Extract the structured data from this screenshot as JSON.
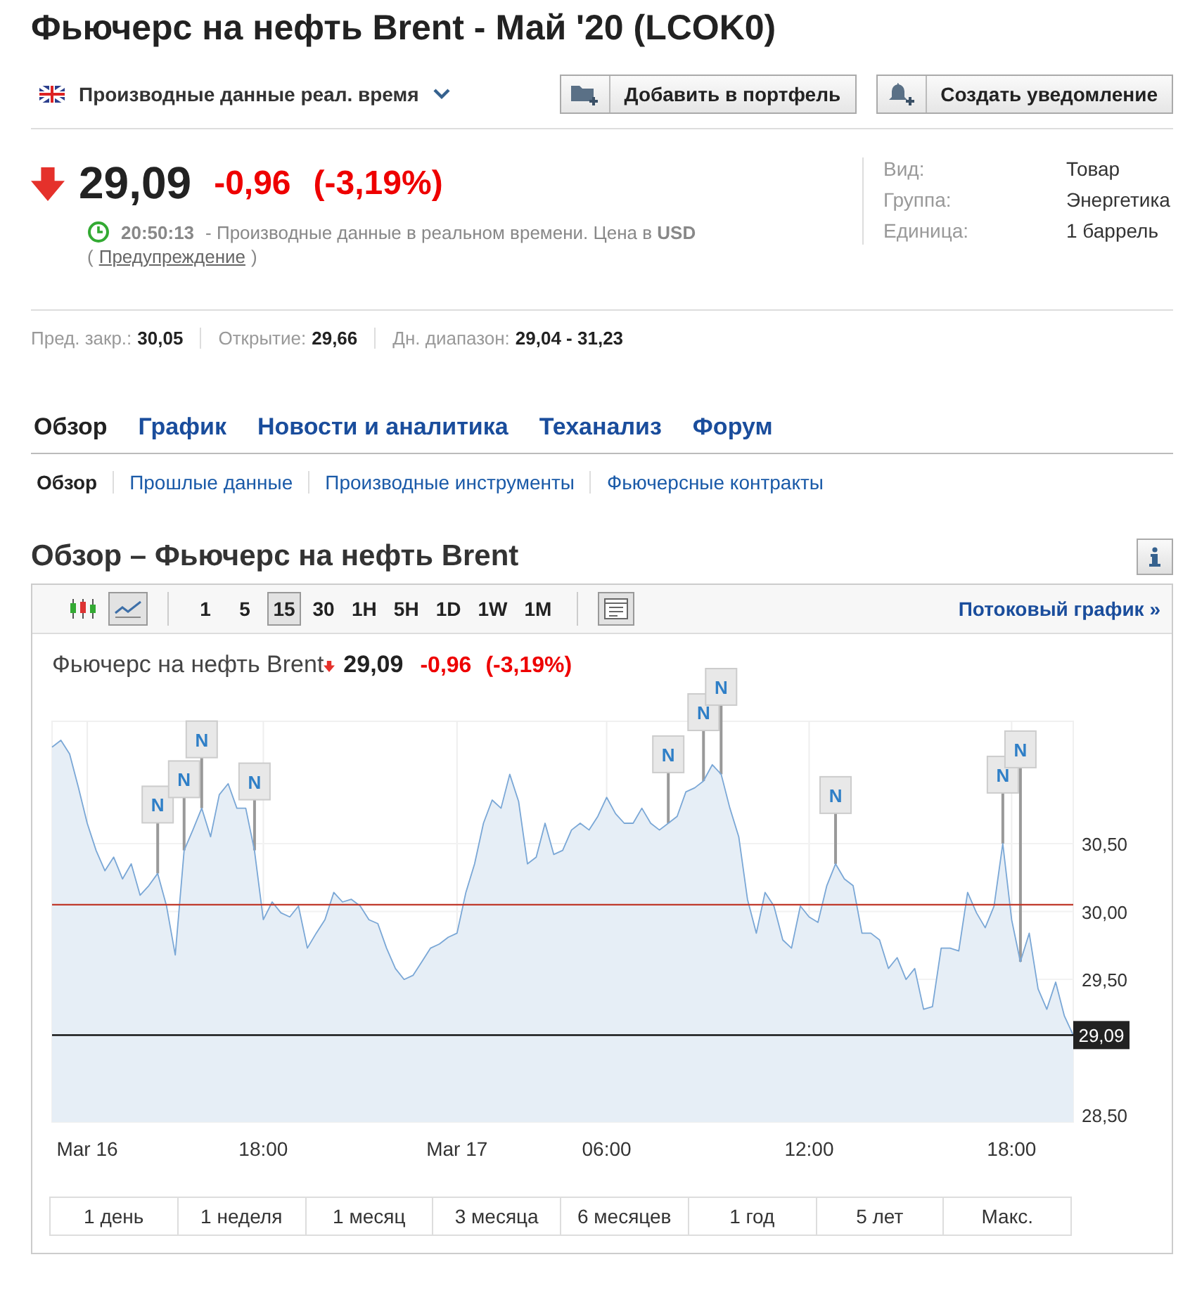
{
  "title": "Фьючерс на нефть Brent - Май '20 (LCOK0)",
  "data_source": {
    "label": "Производные данные реал. время"
  },
  "buttons": [
    {
      "kind": "portfolio",
      "label": "Добавить в портфель"
    },
    {
      "kind": "alert",
      "label": "Создать уведомление"
    }
  ],
  "quote": {
    "falling": true,
    "price": "29,09",
    "change": "-0,96",
    "change_percent": "(-3,19%)",
    "time": "20:50:13",
    "note": "- Производные данные в реальном времени. Цена в **USD**",
    "warning_open": "(",
    "warning_link": "Предупреждение",
    "warning_close": ")"
  },
  "info": [
    {
      "label": "Вид:",
      "value": "Товар"
    },
    {
      "label": "Группа:",
      "value": "Энергетика"
    },
    {
      "label": "Единица:",
      "value": "1 баррель"
    }
  ],
  "stats": [
    {
      "label": "Пред. закр.:",
      "value": "30,05"
    },
    {
      "label": "Открытие:",
      "value": "29,66"
    },
    {
      "label": "Дн. диапазон:",
      "value": "29,04 - 31,23"
    }
  ],
  "tabs": [
    {
      "label": "Обзор",
      "selected": true
    },
    {
      "label": "График",
      "selected": false
    },
    {
      "label": "Новости и аналитика",
      "selected": false
    },
    {
      "label": "Теханализ",
      "selected": false
    },
    {
      "label": "Форум",
      "selected": false
    }
  ],
  "subtabs": [
    {
      "label": "Обзор",
      "selected": true
    },
    {
      "label": "Прошлые данные",
      "selected": false
    },
    {
      "label": "Производные инструменты",
      "selected": false
    },
    {
      "label": "Фьючерсные контракты",
      "selected": false
    }
  ],
  "section_title": "Обзор – Фьючерс на нефть Brent",
  "chart": {
    "chart_types": [
      {
        "kind": "candles",
        "selected": false
      },
      {
        "kind": "line",
        "selected": true
      }
    ],
    "intervals": [
      {
        "label": "1",
        "selected": false
      },
      {
        "label": "5",
        "selected": false
      },
      {
        "label": "15",
        "selected": true
      },
      {
        "label": "30",
        "selected": false
      },
      {
        "label": "1H",
        "selected": false
      },
      {
        "label": "5H",
        "selected": false
      },
      {
        "label": "1D",
        "selected": false
      },
      {
        "label": "1W",
        "selected": false
      },
      {
        "label": "1M",
        "selected": false
      }
    ],
    "stream_link": "Потоковый график »",
    "legend": {
      "name": "Фьючерс на нефть Brent",
      "falling": true,
      "price": "29,09",
      "change": "-0,96",
      "change_percent": "(-3,19%)"
    },
    "chart_data": {
      "type": "area",
      "grid": true,
      "categories": [
        null,
        null,
        null,
        null,
        "Mar 16",
        null,
        null,
        null,
        null,
        null,
        null,
        null,
        null,
        null,
        null,
        null,
        null,
        null,
        null,
        null,
        null,
        null,
        null,
        null,
        "18:00",
        null,
        null,
        null,
        null,
        null,
        null,
        null,
        null,
        null,
        null,
        null,
        null,
        null,
        null,
        null,
        null,
        null,
        null,
        null,
        null,
        null,
        "Mar 17",
        null,
        null,
        null,
        null,
        null,
        null,
        null,
        null,
        null,
        null,
        null,
        null,
        null,
        null,
        null,
        null,
        "06:00",
        null,
        null,
        null,
        null,
        null,
        null,
        null,
        null,
        null,
        null,
        null,
        null,
        null,
        null,
        null,
        null,
        null,
        null,
        null,
        null,
        null,
        null,
        "12:00",
        null,
        null,
        null,
        null,
        null,
        null,
        null,
        null,
        null,
        null,
        null,
        null,
        null,
        null,
        null,
        null,
        null,
        null,
        null,
        null,
        null,
        null,
        "18:00",
        null,
        null,
        null,
        null,
        null,
        null,
        null
      ],
      "yticks": [
        {
          "value": 28.5,
          "label": "28,50"
        },
        {
          "value": 29.5,
          "label": "29,50"
        },
        {
          "value": 30,
          "label": "30,00"
        },
        {
          "value": 30.5,
          "label": "30,50"
        }
      ],
      "ylim": [
        28.45,
        31.4
      ],
      "series": [
        {
          "color": "#7aa7d6",
          "values": [
            31.21,
            31.26,
            31.16,
            30.91,
            30.65,
            30.45,
            30.3,
            30.4,
            30.24,
            30.35,
            30.12,
            30.19,
            30.28,
            30.04,
            29.68,
            30.45,
            30.6,
            30.76,
            30.55,
            30.86,
            30.94,
            30.76,
            30.76,
            30.45,
            29.94,
            30.07,
            29.99,
            29.96,
            30.04,
            29.73,
            29.84,
            29.94,
            30.14,
            30.07,
            30.09,
            30.04,
            29.94,
            29.91,
            29.73,
            29.58,
            29.5,
            29.53,
            29.63,
            29.73,
            29.76,
            29.81,
            29.84,
            30.14,
            30.35,
            30.65,
            30.82,
            30.76,
            31.01,
            30.81,
            30.35,
            30.4,
            30.65,
            30.42,
            30.45,
            30.6,
            30.65,
            30.6,
            30.7,
            30.84,
            30.72,
            30.65,
            30.65,
            30.76,
            30.65,
            30.6,
            30.65,
            30.7,
            30.88,
            30.91,
            30.96,
            31.08,
            31.01,
            30.76,
            30.55,
            30.09,
            29.84,
            30.14,
            30.04,
            29.79,
            29.73,
            30.04,
            29.96,
            29.92,
            30.19,
            30.35,
            30.24,
            30.19,
            29.84,
            29.84,
            29.79,
            29.58,
            29.66,
            29.5,
            29.58,
            29.28,
            29.3,
            29.73,
            29.73,
            29.71,
            30.14,
            29.99,
            29.88,
            30.04,
            30.5,
            29.94,
            29.63,
            29.84,
            29.43,
            29.28,
            29.48,
            29.23,
            29.09
          ]
        }
      ],
      "ref_lines": [
        {
          "axis": "y",
          "value": 30.05,
          "color": "#c0392b"
        },
        {
          "axis": "y",
          "value": 29.09,
          "color": "#000000",
          "label": "29,09"
        }
      ]
    },
    "news_markers": [
      {
        "text": "N",
        "level": 0.1034
      },
      {
        "text": "N",
        "level": 0.1293
      },
      {
        "text": "N",
        "level": 0.1466
      },
      {
        "text": "N",
        "level": 0.1983
      },
      {
        "text": "N",
        "level": 0.6034
      },
      {
        "text": "N",
        "level": 0.6379
      },
      {
        "text": "N",
        "level": 0.6552
      },
      {
        "text": "N",
        "level": 0.7672
      },
      {
        "text": "N",
        "level": 0.931
      },
      {
        "text": "N",
        "level": 0.9483
      }
    ],
    "ranges": [
      {
        "label": "1 день",
        "selected": false
      },
      {
        "label": "1 неделя",
        "selected": false
      },
      {
        "label": "1 месяц",
        "selected": false
      },
      {
        "label": "3 месяца",
        "selected": false
      },
      {
        "label": "6 месяцев",
        "selected": false
      },
      {
        "label": "1 год",
        "selected": false
      },
      {
        "label": "5 лет",
        "selected": false
      },
      {
        "label": "Макс.",
        "selected": false
      }
    ]
  }
}
